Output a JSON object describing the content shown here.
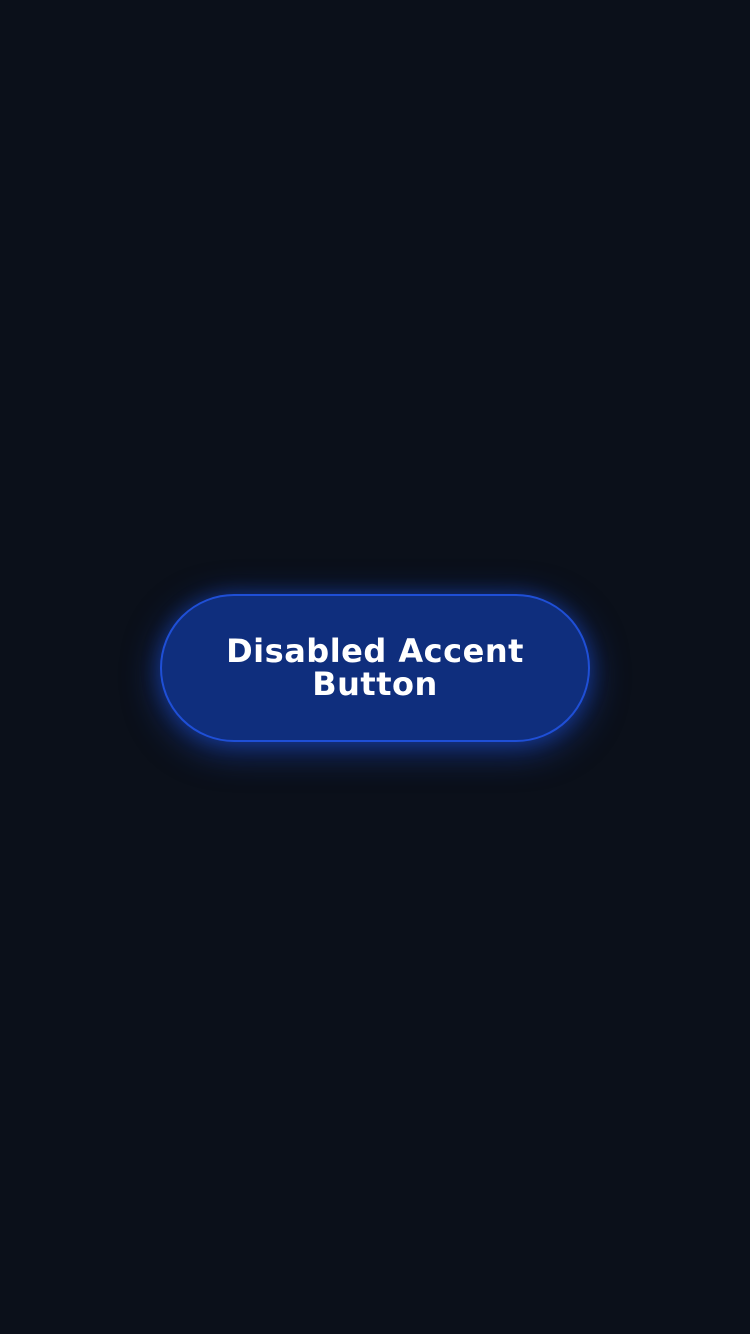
{
  "button": {
    "label": "Disabled Accent Button",
    "state": "disabled"
  },
  "colors": {
    "background": "#0b101a",
    "button_fill": "#0f2e7d",
    "button_border": "#1f4fd6",
    "button_glow": "#1e50dc",
    "label_text": "#ffffff"
  }
}
